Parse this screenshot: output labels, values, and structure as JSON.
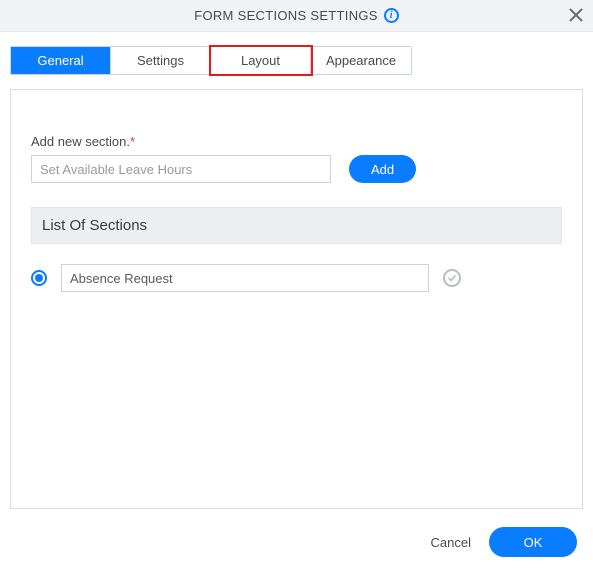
{
  "header": {
    "title": "FORM SECTIONS SETTINGS"
  },
  "tabs": {
    "general": "General",
    "settings": "Settings",
    "layout": "Layout",
    "appearance": "Appearance"
  },
  "add_section": {
    "label": "Add new section.",
    "required_mark": "*",
    "value": "Set Available Leave Hours",
    "add_label": "Add"
  },
  "list": {
    "header": "List Of Sections",
    "items": [
      {
        "name": "Absence Request",
        "active": true
      }
    ]
  },
  "footer": {
    "cancel": "Cancel",
    "ok": "OK"
  }
}
